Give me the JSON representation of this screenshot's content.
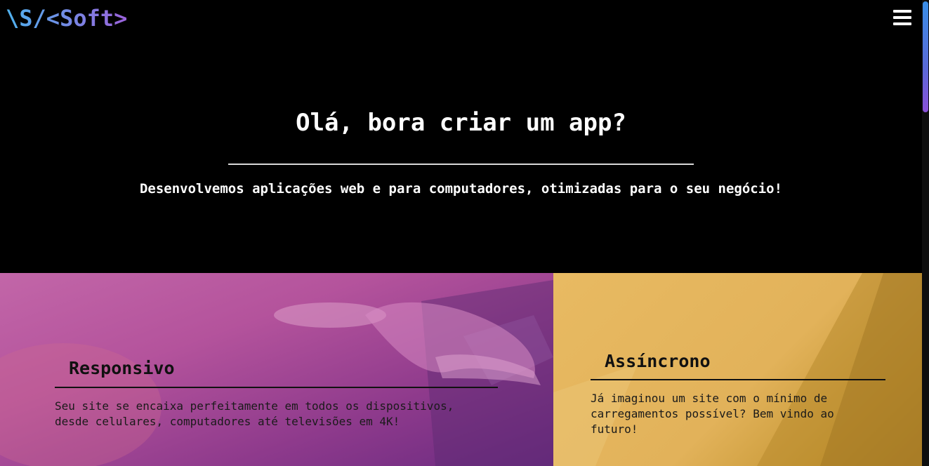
{
  "brand": {
    "logo_text": "\\S/<Soft>"
  },
  "nav": {
    "menu_icon": "hamburger-menu-icon"
  },
  "hero": {
    "title": "Olá, bora criar um app?",
    "subtitle": "Desenvolvemos aplicações web e para computadores, otimizadas para o seu negócio!"
  },
  "features": [
    {
      "title": "Responsivo",
      "text_line1": "Seu site se encaixa perfeitamente em todos os dispositivos,",
      "text_line2": "desde celulares, computadores até televisões em 4K!"
    },
    {
      "title": "Assíncrono",
      "text_line1": "Já imaginou um site com o mínimo de",
      "text_line2": "carregamentos possível? Bem vindo ao",
      "text_line3": "futuro!"
    }
  ],
  "colors": {
    "background": "#000000",
    "logo_gradient_start": "#4fb2ee",
    "logo_gradient_end": "#9b62db",
    "card_left": "#b4539c",
    "card_right": "#e2b25a"
  }
}
